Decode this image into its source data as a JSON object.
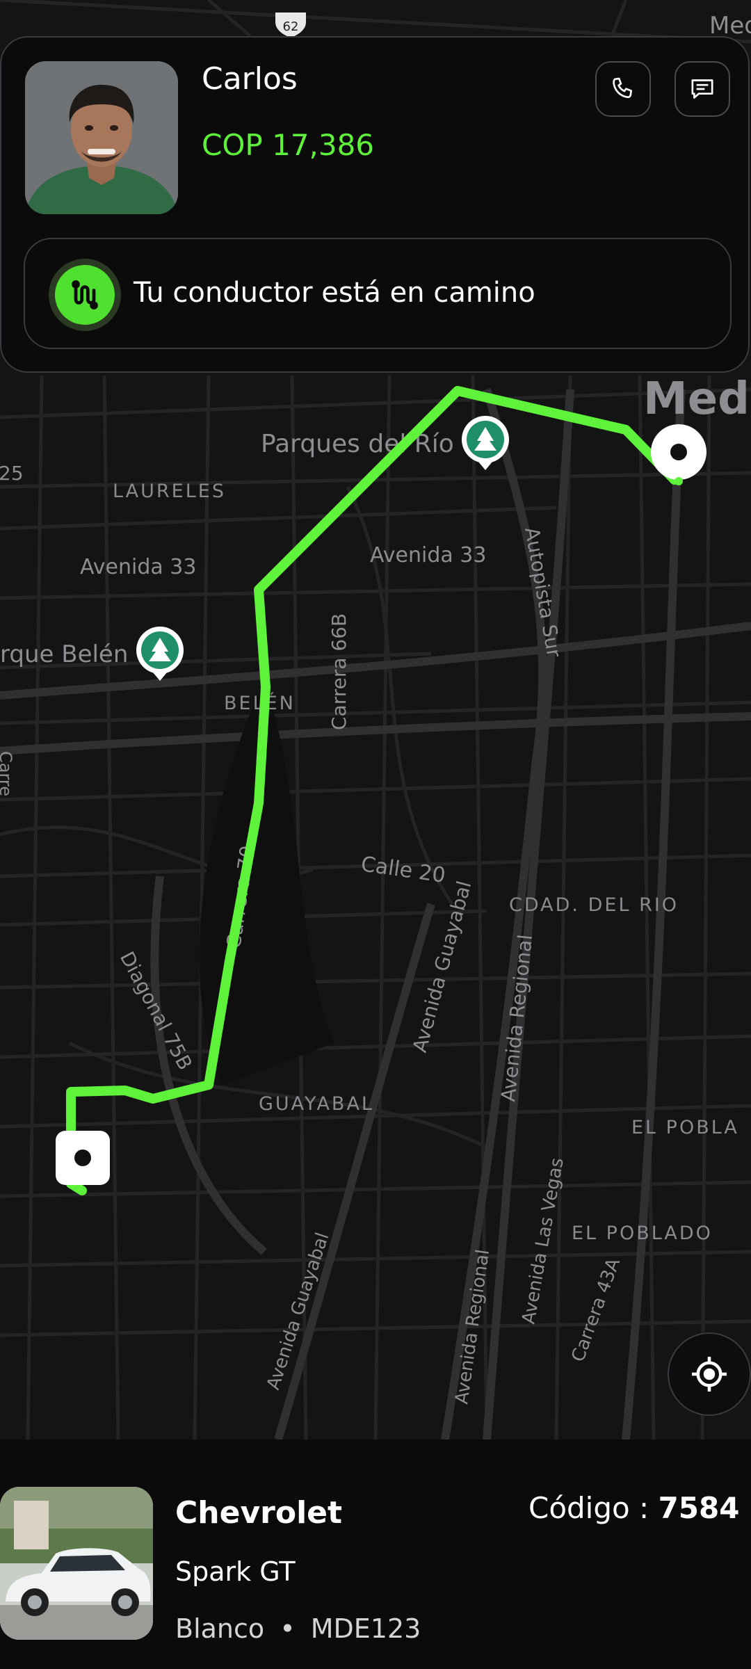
{
  "driver": {
    "name": "Carlos",
    "price": "COP 17,386",
    "status": "Tu conductor está en camino",
    "photo_icon": "driver-photo",
    "call_icon": "phone-icon",
    "chat_icon": "message-icon",
    "status_icon": "route-icon"
  },
  "map": {
    "road_shield": "62",
    "city_label": "Medellín",
    "partial_city_label_top": "Med",
    "partial_city_label": "Mede",
    "labels": {
      "parques_del_rio": "Parques del Río",
      "laureles": "LAURELES",
      "avenida_33_left": "Avenida 33",
      "avenida_33_center": "Avenida 33",
      "autopista_sur": "Autopista Sur",
      "parque_belen": "rque Belén",
      "carrera_66b": "Carrera 66B",
      "belen": "BELÉN",
      "carrera_70": "Carrera 70",
      "calle_20": "Calle 20",
      "cdad_del_rio": "CDAD. DEL RIO",
      "avenida_guayabal_center": "Avenida Guayabal",
      "avenida_regional_center": "Avenida Regional",
      "diagonal_75b": "Diagonal 75B",
      "guayabal": "GUAYABAL",
      "el_pobla": "EL POBLA",
      "avenida_las_vegas": "Avenida Las Vegas",
      "el_poblado": "EL POBLADO",
      "avenida_guayabal_bottom": "Avenida Guayabal",
      "avenida_regional_bottom": "Avenida Regional",
      "carrera_43a": "Carrera 43A",
      "left_edge_number": "25",
      "left_edge_carrera": "Carre"
    },
    "route_color": "#5ef23a",
    "locate_icon": "crosshair-icon"
  },
  "vehicle": {
    "brand": "Chevrolet",
    "model": "Spark GT",
    "color": "Blanco",
    "separator": "•",
    "plate": "MDE123",
    "code_label": "Código :",
    "code_value": "7584"
  },
  "colors": {
    "accent": "#5ef23a",
    "background": "#0b0b0c",
    "map_background": "#131314",
    "park_marker": "#1f8f68"
  }
}
